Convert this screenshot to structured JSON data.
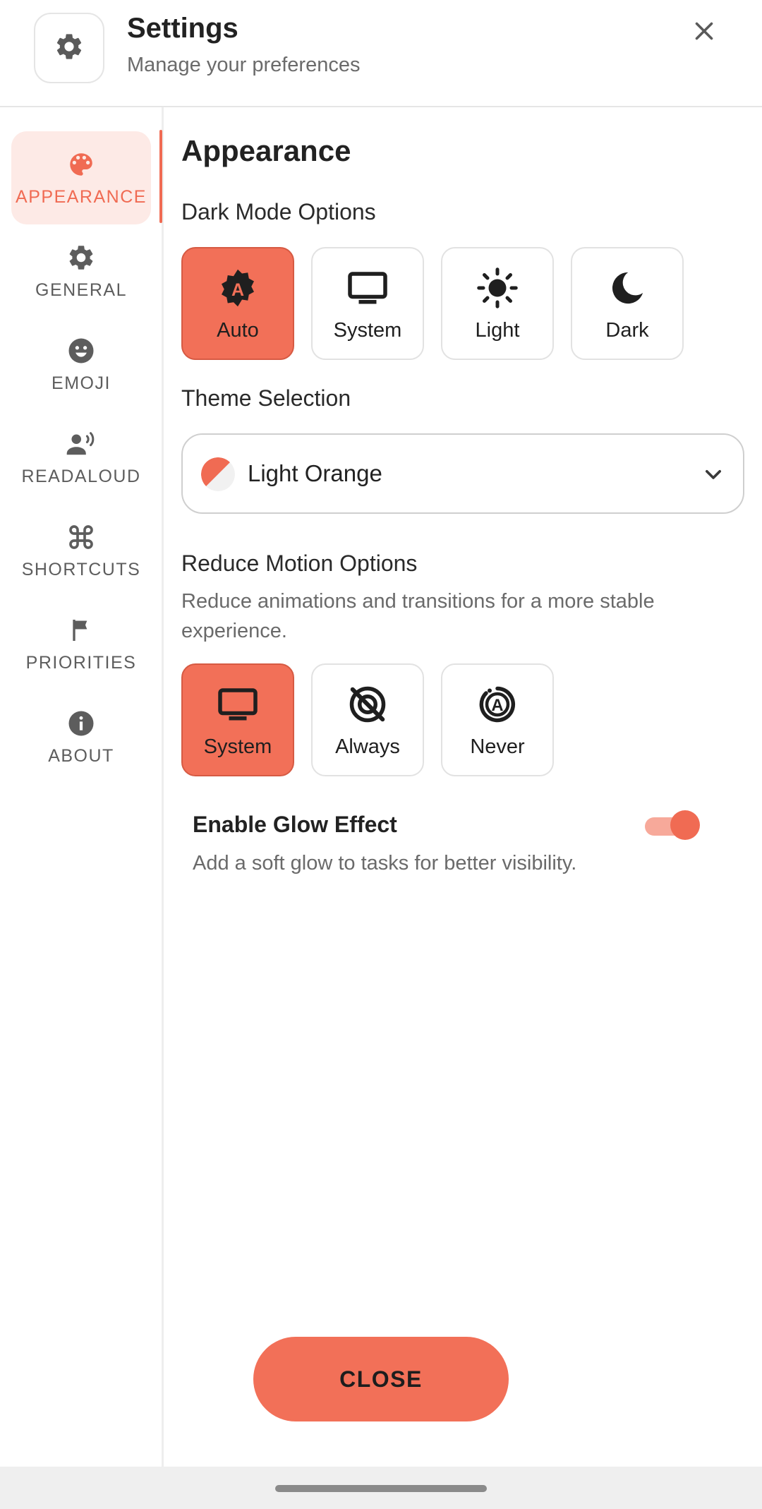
{
  "header": {
    "title": "Settings",
    "subtitle": "Manage your preferences",
    "icon": "gear-icon",
    "close_icon": "close-icon"
  },
  "sidebar": {
    "items": [
      {
        "label": "APPEARANCE",
        "icon": "palette-icon",
        "active": true
      },
      {
        "label": "GENERAL",
        "icon": "gear-icon",
        "active": false
      },
      {
        "label": "EMOJI",
        "icon": "smiley-icon",
        "active": false
      },
      {
        "label": "READALOUD",
        "icon": "speaker-person-icon",
        "active": false
      },
      {
        "label": "SHORTCUTS",
        "icon": "command-icon",
        "active": false
      },
      {
        "label": "PRIORITIES",
        "icon": "flag-icon",
        "active": false
      },
      {
        "label": "ABOUT",
        "icon": "info-icon",
        "active": false
      }
    ]
  },
  "main": {
    "section_title": "Appearance",
    "dark_mode": {
      "heading": "Dark Mode Options",
      "options": [
        {
          "label": "Auto",
          "icon": "auto-brightness-icon",
          "selected": true
        },
        {
          "label": "System",
          "icon": "monitor-icon",
          "selected": false
        },
        {
          "label": "Light",
          "icon": "sun-icon",
          "selected": false
        },
        {
          "label": "Dark",
          "icon": "moon-icon",
          "selected": false
        }
      ]
    },
    "theme": {
      "heading": "Theme Selection",
      "selected": "Light Orange",
      "swatch_colors": [
        "#f06b53",
        "#f1f1f1"
      ]
    },
    "reduce_motion": {
      "heading": "Reduce Motion Options",
      "description": "Reduce animations and transitions for a more stable experience.",
      "options": [
        {
          "label": "System",
          "icon": "monitor-icon",
          "selected": true
        },
        {
          "label": "Always",
          "icon": "motion-off-icon",
          "selected": false
        },
        {
          "label": "Never",
          "icon": "auto-motion-icon",
          "selected": false
        }
      ]
    },
    "glow": {
      "title": "Enable Glow Effect",
      "description": "Add a soft glow to tasks for better visibility.",
      "enabled": true
    },
    "close_label": "CLOSE"
  },
  "colors": {
    "accent": "#f06b53",
    "accent_light": "#fdeae6"
  }
}
